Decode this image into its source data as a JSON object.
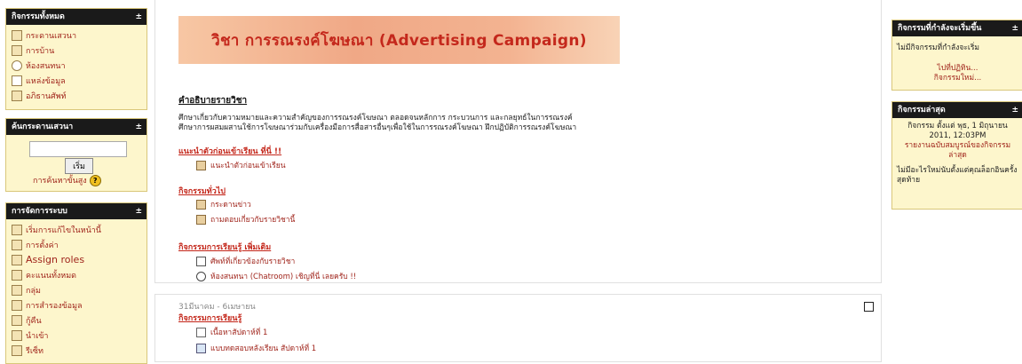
{
  "left": {
    "activities": {
      "title": "กิจกรรมทั้งหมด",
      "toggle": "±",
      "items": [
        {
          "label": "กระดานเสวนา",
          "icon": "forum-icon"
        },
        {
          "label": "การบ้าน",
          "icon": "assignment-icon"
        },
        {
          "label": "ห้องสนทนา",
          "icon": "chat-icon"
        },
        {
          "label": "แหล่งข้อมูล",
          "icon": "resource-icon"
        },
        {
          "label": "อภิธานศัพท์",
          "icon": "glossary-icon"
        }
      ]
    },
    "search": {
      "title": "ค้นกระดานเสวนา",
      "toggle": "±",
      "button": "เริ่ม",
      "advanced": "การค้นหาขั้นสูง",
      "help": "?"
    },
    "admin": {
      "title": "การจัดการระบบ",
      "toggle": "±",
      "items": [
        {
          "label": "เริ่มการแก้ไขในหน้านี้",
          "icon": "edit-icon"
        },
        {
          "label": "การตั้งค่า",
          "icon": "settings-icon"
        },
        {
          "label": "Assign roles",
          "icon": "roles-icon"
        },
        {
          "label": "คะแนนทั้งหมด",
          "icon": "grades-icon"
        },
        {
          "label": "กลุ่ม",
          "icon": "groups-icon"
        },
        {
          "label": "การสำรองข้อมูล",
          "icon": "backup-icon"
        },
        {
          "label": "กู้คืน",
          "icon": "restore-icon"
        },
        {
          "label": "นำเข้า",
          "icon": "import-icon"
        },
        {
          "label": "รีเซ็ท",
          "icon": "reset-icon"
        }
      ]
    }
  },
  "center": {
    "banner": "วิชา การรณรงค์โฆษณา (Advertising Campaign)",
    "course_desc_title": "คำอธิบายรายวิชา",
    "course_desc": [
      "ศึกษาเกี่ยวกับความหมายและความสำคัญของการรณรงค์โฆษณา ตลอดจนหลักการ กระบวนการ และกลยุทธ์ในการรณรงค์",
      "ศึกษาการผสมผสานใช้การโฆษณาร่วมกับเครื่องมือการสื่อสารอื่นๆเพื่อใช้ในการรณรงค์โฆษณา ฝึกปฏิบัติการรณรงค์โฆษณา"
    ],
    "sections": [
      {
        "title": "แนะนำตัวก่อนเข้าเรียน ที่นี่ !!",
        "items": [
          {
            "label": "แนะนำตัวก่อนเข้าเรียน",
            "icon": "forum-icon"
          }
        ]
      },
      {
        "title": "กิจกรรมทั่วไป",
        "items": [
          {
            "label": "กระดานข่าว",
            "icon": "forum-icon"
          },
          {
            "label": "ถามตอบเกี่ยวกับรายวิชานี้",
            "icon": "forum-icon"
          }
        ]
      },
      {
        "title": "กิจกรรมการเรียนรู้ เพิ่มเติม",
        "items": [
          {
            "label": "ศัพท์ที่เกี่ยวข้องกับรายวิชา",
            "icon": "glossary-icon"
          },
          {
            "label": "ห้องสนทนา (Chatroom) เชิญที่นี่ เลยครับ !!",
            "icon": "chat-icon"
          }
        ]
      }
    ],
    "week": {
      "date": "31มีนาคม - 6เมษายน",
      "title": "กิจกรรมการเรียนรู้",
      "items": [
        {
          "label": "เนื้อหาสัปดาห์ที่ 1",
          "icon": "content-icon"
        },
        {
          "label": "แบบทดสอบหลังเรียน สัปดาห์ที่ 1",
          "icon": "quiz-icon"
        }
      ]
    }
  },
  "right": {
    "upcoming": {
      "title": "กิจกรรมที่กำลังจะเริ่มขึ้น",
      "toggle": "±",
      "empty": "ไม่มีกิจกรรมที่กำลังจะเริ่ม",
      "calendar_link": "ไปที่ปฏิทิน...",
      "new_event": "กิจกรรมใหม่..."
    },
    "recent": {
      "title": "กิจกรรมล่าสุด",
      "toggle": "±",
      "since": "กิจกรรม ตั้งแต่ พุธ, 1 มิถุนายน 2011, 12:03PM",
      "full_report": "รายงานฉบับสมบูรณ์ของกิจกรรมล่าสุด",
      "nothing": "ไม่มีอะไรใหม่นับตั้งแต่คุณล็อกอินครั้งสุดท้าย"
    }
  }
}
